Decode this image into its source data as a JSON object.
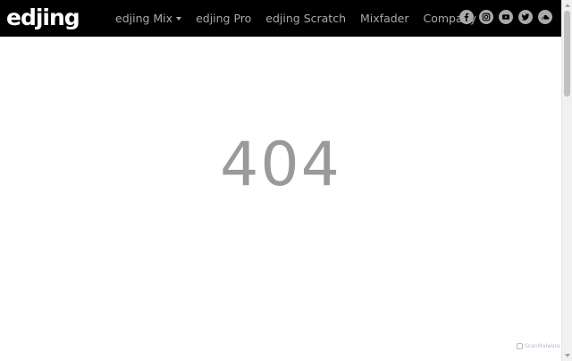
{
  "header": {
    "logo_text": "edjing",
    "nav": [
      {
        "label": "edjing Mix",
        "has_dropdown": true
      },
      {
        "label": "edjing Pro",
        "has_dropdown": false
      },
      {
        "label": "edjing Scratch",
        "has_dropdown": false
      },
      {
        "label": "Mixfader",
        "has_dropdown": false
      },
      {
        "label": "Company",
        "has_dropdown": true
      }
    ],
    "social_icons": [
      "facebook-icon",
      "instagram-icon",
      "youtube-icon",
      "twitter-icon",
      "soundcloud-icon"
    ]
  },
  "main": {
    "error_code": "404"
  },
  "watermark": {
    "text": "ScanMalware"
  },
  "colors": {
    "navbar_bg": "#000000",
    "nav_text": "#a9a9a9",
    "error_text": "#9a9a9a",
    "page_bg": "#ffffff"
  }
}
